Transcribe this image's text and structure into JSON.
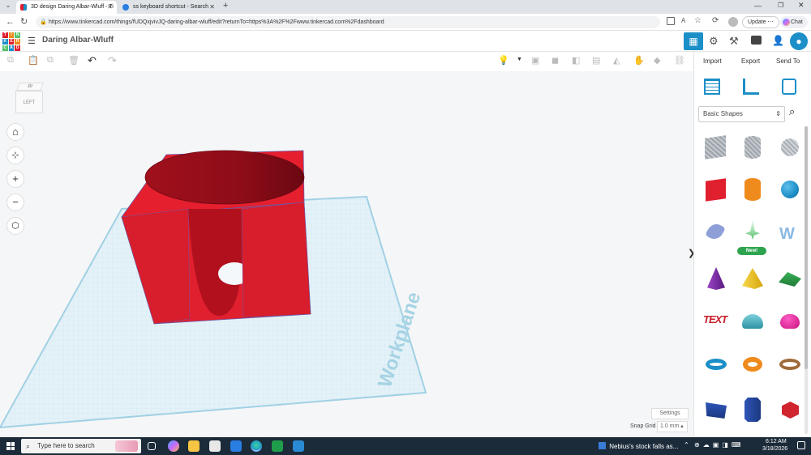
{
  "browser": {
    "tabs": [
      {
        "title": "3D design Daring Albar-Wluff - Ti",
        "active": true
      },
      {
        "title": "ss keyboard shortcut - Search",
        "active": false
      }
    ],
    "url": "https://www.tinkercad.com/things/fUDQxjvivJQ-daring-albar-wluff/edit?returnTo=https%3A%2F%2Fwww.tinkercad.com%2Fdashboard",
    "update_label": "Update",
    "chat_label": "Chat"
  },
  "app": {
    "logo_letters": [
      "T",
      "I",
      "N",
      "K",
      "E",
      "R",
      "C",
      "A",
      "D"
    ],
    "design_title": "Daring Albar-Wluff",
    "actions": {
      "import": "Import",
      "export": "Export",
      "send_to": "Send To"
    }
  },
  "viewport": {
    "view_cube_label": "LEFT",
    "view_cube_top": "Bt",
    "workplane_label": "Workplane",
    "settings_label": "Settings",
    "snap_grid_label": "Snap Grid",
    "snap_grid_value": "1.0 mm"
  },
  "panel": {
    "category": "Basic Shapes",
    "new_badge": "New!",
    "shapes": [
      {
        "name": "box-hole",
        "color": "#a9afb6"
      },
      {
        "name": "cylinder-hole",
        "color": "#a9afb6"
      },
      {
        "name": "sphere-hole",
        "color": "#b8bcc2"
      },
      {
        "name": "box",
        "color": "#e0202f"
      },
      {
        "name": "cylinder",
        "color": "#ef8a1c"
      },
      {
        "name": "sphere",
        "color": "#1d8fc8"
      },
      {
        "name": "scribble",
        "color": "#7c8ed0"
      },
      {
        "name": "shape-generator",
        "color": "#56c36b"
      },
      {
        "name": "text-wave",
        "color": "#7ab0e0"
      },
      {
        "name": "cone",
        "color": "#7b2aa7"
      },
      {
        "name": "pyramid",
        "color": "#f0c419"
      },
      {
        "name": "roof",
        "color": "#2c9c46"
      },
      {
        "name": "text",
        "color": "#d0242f"
      },
      {
        "name": "half-sphere",
        "color": "#4ab7c7"
      },
      {
        "name": "paraboloid",
        "color": "#d7158f"
      },
      {
        "name": "torus",
        "color": "#1d8fc8"
      },
      {
        "name": "tube",
        "color": "#ef8a1c"
      },
      {
        "name": "ring",
        "color": "#a06b3a"
      },
      {
        "name": "wedge",
        "color": "#22449a"
      },
      {
        "name": "polygon",
        "color": "#22449a"
      },
      {
        "name": "icosahedron",
        "color": "#d0242f"
      }
    ]
  },
  "taskbar": {
    "search_placeholder": "Type here to search",
    "news": "Nebius's stock falls as...",
    "time": "6:12 AM",
    "date": "3/18/2026"
  }
}
